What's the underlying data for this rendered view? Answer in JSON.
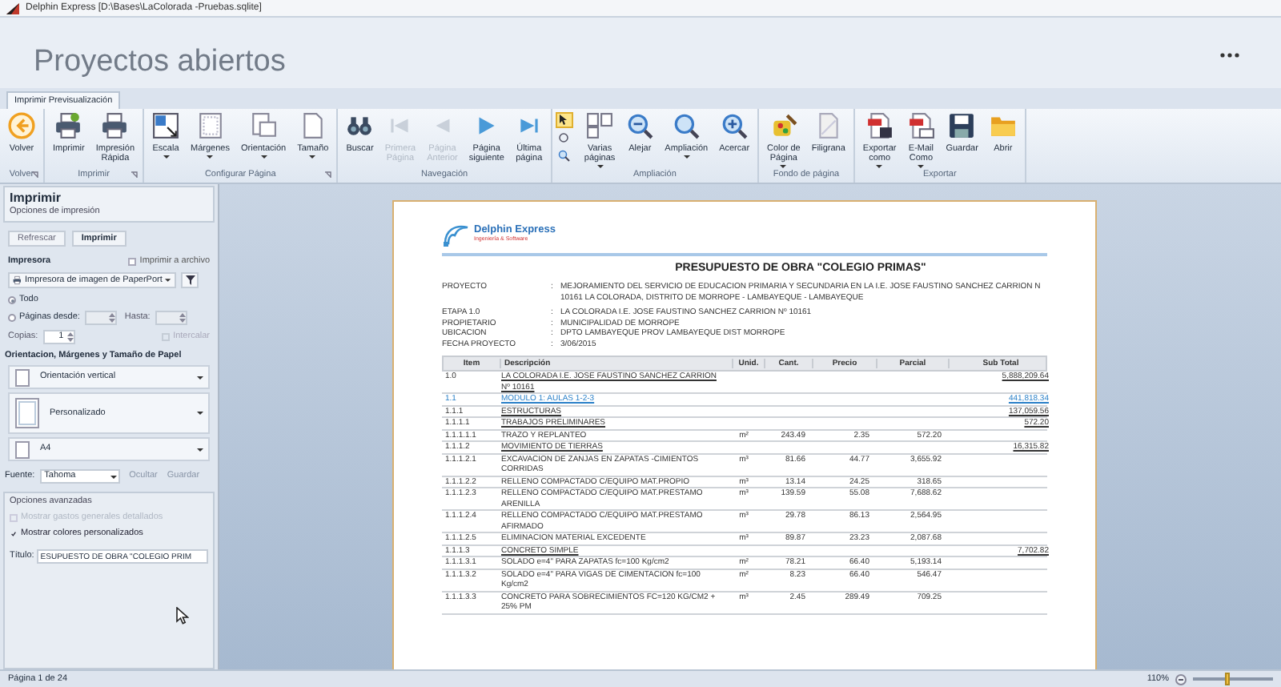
{
  "window": {
    "title": "Delphin Express [D:\\Bases\\LaColorada -Pruebas.sqlite]"
  },
  "header": {
    "title": "Proyectos abiertos"
  },
  "ribbon": {
    "tabs": [
      {
        "label": "Imprimir Previsualización",
        "selected": true
      }
    ],
    "groups": [
      {
        "label": "Volver",
        "launcher": true,
        "buttons": [
          {
            "label": "Volver",
            "disabled": false,
            "dropdown": false
          }
        ]
      },
      {
        "label": "Imprimir",
        "launcher": true,
        "buttons": [
          {
            "label": "Imprimir",
            "disabled": false,
            "dropdown": false
          },
          {
            "label": "Impresión\nRápida",
            "disabled": false,
            "dropdown": false
          }
        ]
      },
      {
        "label": "Configurar Página",
        "launcher": true,
        "buttons": [
          {
            "label": "Escala",
            "disabled": false,
            "dropdown": true
          },
          {
            "label": "Márgenes",
            "disabled": false,
            "dropdown": true
          },
          {
            "label": "Orientación",
            "disabled": false,
            "dropdown": true
          },
          {
            "label": "Tamaño",
            "disabled": false,
            "dropdown": true
          }
        ]
      },
      {
        "label": "Navegación",
        "launcher": false,
        "buttons": [
          {
            "label": "Buscar",
            "disabled": false,
            "dropdown": false
          },
          {
            "label": "Primera\nPágina",
            "disabled": true,
            "dropdown": false
          },
          {
            "label": "Página\nAnterior",
            "disabled": true,
            "dropdown": false
          },
          {
            "label": "Página\nsiguiente",
            "disabled": false,
            "dropdown": false
          },
          {
            "label": "Última\npágina",
            "disabled": false,
            "dropdown": false
          }
        ]
      },
      {
        "label": "Ampliación",
        "launcher": false,
        "tools": [
          {
            "selected": true
          },
          {
            "selected": false
          },
          {
            "selected": false
          }
        ],
        "buttons": [
          {
            "label": "Varias\npáginas",
            "disabled": false,
            "dropdown": true
          },
          {
            "label": "Alejar",
            "disabled": false,
            "dropdown": false
          },
          {
            "label": "Ampliación",
            "disabled": false,
            "dropdown": true
          },
          {
            "label": "Acercar",
            "disabled": false,
            "dropdown": false
          }
        ]
      },
      {
        "label": "Fondo de página",
        "launcher": false,
        "buttons": [
          {
            "label": "Color de\nPágina",
            "disabled": false,
            "dropdown": true
          },
          {
            "label": "Filigrana",
            "disabled": false,
            "dropdown": false
          }
        ]
      },
      {
        "label": "Exportar",
        "launcher": false,
        "buttons": [
          {
            "label": "Exportar\ncomo",
            "disabled": false,
            "dropdown": true
          },
          {
            "label": "E-Mail\nComo",
            "disabled": false,
            "dropdown": true
          },
          {
            "label": "Guardar",
            "disabled": false,
            "dropdown": false
          },
          {
            "label": "Abrir",
            "disabled": false,
            "dropdown": false
          }
        ]
      }
    ]
  },
  "print_panel": {
    "title": "Imprimir",
    "subtitle": "Opciones de impresión",
    "buttons": [
      "Refrescar",
      "Imprimir"
    ],
    "printer_label": "Impresora",
    "print_to_file": {
      "label": "Imprimir a archivo",
      "checked": false
    },
    "printer": "Impresora de imagen de PaperPort",
    "range": [
      {
        "label": "Todo",
        "selected": true
      },
      {
        "label": "Páginas desde:",
        "selected": false
      }
    ],
    "to_label": "Hasta:",
    "copies_label": "Copias:",
    "copies": "1",
    "collate": {
      "label": "Intercalar",
      "checked": false,
      "disabled": true
    },
    "paper_heading": "Orientacion, Márgenes y Tamaño de Papel",
    "paper_options": [
      "Orientación vertical",
      "Personalizado",
      "A4"
    ],
    "font_label": "Fuente:",
    "font": "Tahoma",
    "links": [
      "Ocultar",
      "Guardar"
    ],
    "advanced": {
      "title": "Opciones avanzadas",
      "options": [
        {
          "label": "Mostrar gastos generales detallados",
          "checked": false,
          "disabled": true
        },
        {
          "label": "Mostrar colores personalizados",
          "checked": true,
          "disabled": false
        }
      ],
      "title_label": "Título:",
      "title_value": "ESUPUESTO DE OBRA \"COLEGIO PRIM"
    }
  },
  "document": {
    "logo": {
      "name": "Delphin Express",
      "tagline": "Ingeniería & Software"
    },
    "title": "PRESUPUESTO DE OBRA \"COLEGIO PRIMAS\"",
    "info": [
      {
        "label": "PROYECTO",
        "colon": ":",
        "value": "MEJORAMIENTO DEL SERVICIO DE EDUCACION PRIMARIA Y SECUNDARIA EN LA I.E. JOSE FAUSTINO SANCHEZ CARRION N 10161 LA COLORADA, DISTRITO DE MORROPE - LAMBAYEQUE - LAMBAYEQUE"
      },
      {
        "label": "ETAPA 1.0",
        "colon": ":",
        "value": "LA COLORADA I.E. JOSE FAUSTINO SANCHEZ CARRION Nº 10161"
      },
      {
        "label": "PROPIETARIO",
        "colon": ":",
        "value": "MUNICIPALIDAD DE MORROPE"
      },
      {
        "label": "UBICACION",
        "colon": ":",
        "value": "DPTO LAMBAYEQUE PROV LAMBAYEQUE DIST MORROPE"
      },
      {
        "label": "FECHA PROYECTO",
        "colon": ":",
        "value": "3/06/2015"
      }
    ],
    "columns": [
      "Item",
      "Descripción",
      "Unid.",
      "Cant.",
      "Precio",
      "Parcial",
      "Sub Total"
    ],
    "rows": [
      {
        "kind": "title",
        "item": "1.0",
        "description": "LA COLORADA I.E. JOSE FAUSTINO SANCHEZ CARRION Nº 10161",
        "subtotal": "5,888,209.64"
      },
      {
        "kind": "module",
        "item": "1.1",
        "description": "MODULO 1: AULAS 1-2-3",
        "subtotal": "441,818.34"
      },
      {
        "kind": "group",
        "item": "1.1.1",
        "description": "ESTRUCTURAS",
        "subtotal": "137,059.56"
      },
      {
        "kind": "group",
        "item": "1.1.1.1",
        "description": "TRABAJOS PRELIMINARES",
        "subtotal": "572.20"
      },
      {
        "kind": "item",
        "item": "1.1.1.1.1",
        "description": "TRAZO Y REPLANTEO",
        "unit": "m²",
        "qty": "243.49",
        "price": "2.35",
        "partial": "572.20"
      },
      {
        "kind": "group",
        "item": "1.1.1.2",
        "description": "MOVIMIENTO DE TIERRAS",
        "subtotal": "16,315.82"
      },
      {
        "kind": "item",
        "item": "1.1.1.2.1",
        "description": "EXCAVACION DE ZANJAS EN ZAPATAS -CIMIENTOS CORRIDAS",
        "unit": "m³",
        "qty": "81.66",
        "price": "44.77",
        "partial": "3,655.92"
      },
      {
        "kind": "item",
        "item": "1.1.1.2.2",
        "description": "RELLENO COMPACTADO C/EQUIPO MAT.PROPIO",
        "unit": "m³",
        "qty": "13.14",
        "price": "24.25",
        "partial": "318.65"
      },
      {
        "kind": "item",
        "item": "1.1.1.2.3",
        "description": "RELLENO COMPACTADO C/EQUIPO MAT.PRESTAMO ARENILLA",
        "unit": "m³",
        "qty": "139.59",
        "price": "55.08",
        "partial": "7,688.62"
      },
      {
        "kind": "item",
        "item": "1.1.1.2.4",
        "description": "RELLENO COMPACTADO C/EQUIPO MAT.PRESTAMO AFIRMADO",
        "unit": "m³",
        "qty": "29.78",
        "price": "86.13",
        "partial": "2,564.95"
      },
      {
        "kind": "item",
        "item": "1.1.1.2.5",
        "description": "ELIMINACION MATERIAL EXCEDENTE",
        "unit": "m³",
        "qty": "89.87",
        "price": "23.23",
        "partial": "2,087.68"
      },
      {
        "kind": "group",
        "item": "1.1.1.3",
        "description": "CONCRETO SIMPLE",
        "subtotal": "7,702.82"
      },
      {
        "kind": "item",
        "item": "1.1.1.3.1",
        "description": "SOLADO e=4\" PARA ZAPATAS fc=100 Kg/cm2",
        "unit": "m²",
        "qty": "78.21",
        "price": "66.40",
        "partial": "5,193.14"
      },
      {
        "kind": "item",
        "item": "1.1.1.3.2",
        "description": "SOLADO e=4\" PARA VIGAS DE CIMENTACION fc=100 Kg/cm2",
        "unit": "m²",
        "qty": "8.23",
        "price": "66.40",
        "partial": "546.47"
      },
      {
        "kind": "item",
        "item": "1.1.1.3.3",
        "description": "CONCRETO PARA SOBRECIMIENTOS FC=120 KG/CM2 + 25% PM",
        "unit": "m³",
        "qty": "2.45",
        "price": "289.49",
        "partial": "709.25"
      }
    ]
  },
  "status_bar": {
    "page": "Página 1 de 24",
    "zoom": "110%",
    "zoom_slider": {
      "level": 0.4
    }
  }
}
